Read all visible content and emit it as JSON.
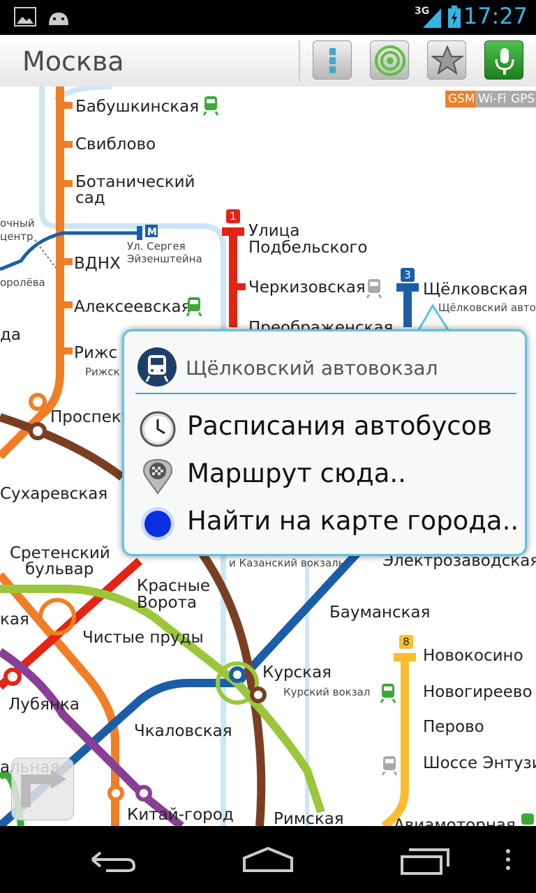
{
  "status_bar": {
    "time": "17:27",
    "network": "3G"
  },
  "toolbar": {
    "title": "Москва",
    "buttons": [
      {
        "name": "list-view-button",
        "icon": "list-icon"
      },
      {
        "name": "gps-button",
        "icon": "target-icon"
      },
      {
        "name": "favorites-button",
        "icon": "star-icon"
      },
      {
        "name": "voice-search-button",
        "icon": "microphone-icon"
      }
    ]
  },
  "signal": {
    "gsm": "GSM",
    "wifi": "Wi-Fi",
    "gps": "GPS"
  },
  "lines": {
    "l1": "1",
    "l3": "3",
    "l8": "8"
  },
  "stations": {
    "babushkinskaya": "Бабушкинская",
    "sviblovo": "Свиблово",
    "botanichesky_1": "Ботанический",
    "botanichesky_2": "сад",
    "ochny_1": "очный",
    "ochny_2": "центр",
    "koroleva": "оролёва",
    "ul_sergeya_1": "Ул. Сергея",
    "ul_sergeya_2": "Эйзенштейна",
    "vdnh": "ВДНХ",
    "alekseevskaya": "Алексеевская",
    "da": "да",
    "rizhskaya": "Рижс",
    "rizhsky_station": "Рижск",
    "prospekt": "Проспект",
    "sukharevskaya": "Сухаревская",
    "sretensky_1": "Сретенский",
    "sretensky_2": "бульвар",
    "kaya": "кая",
    "krasnye_1": "Красные",
    "krasnye_2": "Ворота",
    "chistye": "Чистые пруды",
    "lubyanka": "Лубянка",
    "kurskaya": "Курская",
    "kursky_station": "Курский вокзал",
    "chkalovskaya": "Чкаловская",
    "alnaya": "альная",
    "kitay": "Китай-город",
    "rimskaya": "Римская",
    "ul_podbelskogo_1": "Улица",
    "ul_podbelskogo_2": "Подбельского",
    "cherkizovskaya": "Черкизовская",
    "preobrazhenskaya": "Преображенская",
    "shchelkovskaya": "Щёлковская",
    "shchelkovsky_av": "Щёлковский автовок",
    "kazansky": "и Казанский вокзалы",
    "elektrozavodskaya": "Электрозаводская",
    "baumanskaya": "Бауманская",
    "novokosino": "Новокосино",
    "novogireevo": "Новогиреево",
    "perovo": "Перово",
    "shosse": "Шоссе Энтузиа",
    "aviamotornaya": "Авиамоторная"
  },
  "popup": {
    "title": "Щёлковский автовокзал",
    "items": [
      {
        "label": "Расписания автобусов",
        "icon": "clock-icon"
      },
      {
        "label": "Маршрут сюда..",
        "icon": "route-pin-icon"
      },
      {
        "label": "Найти на карте города..",
        "icon": "blue-dot-icon"
      }
    ]
  },
  "colors": {
    "line_orange": "#f07e26",
    "line_red": "#e42313",
    "line_blue": "#1b5ea8",
    "line_brown": "#7a3f22",
    "line_yellow": "#fbbd2e",
    "line_lime": "#9bc63c",
    "line_purple": "#8a3f97",
    "accent": "#33b5e5"
  }
}
